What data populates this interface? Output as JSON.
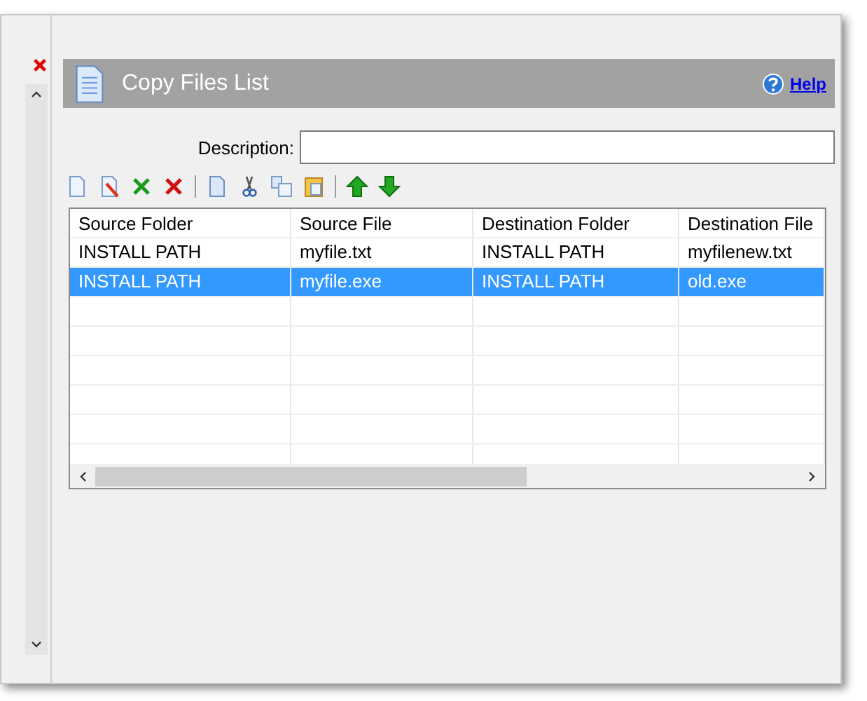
{
  "panel": {
    "title": "Copy Files List",
    "help": "Help"
  },
  "description": {
    "label": "Description:"
  },
  "toolbar": [
    {
      "kind": "new"
    },
    {
      "kind": "edit"
    },
    {
      "kind": "check-x"
    },
    {
      "kind": "delete"
    },
    {
      "kind": "sep"
    },
    {
      "kind": "copy"
    },
    {
      "kind": "cut"
    },
    {
      "kind": "duplicate"
    },
    {
      "kind": "paste"
    },
    {
      "kind": "sep"
    },
    {
      "kind": "up"
    },
    {
      "kind": "down"
    }
  ],
  "table": {
    "columns": [
      "Source Folder",
      "Source File",
      "Destination Folder",
      "Destination File"
    ],
    "rows": [
      {
        "cells": [
          "INSTALL PATH",
          "myfile.txt",
          "INSTALL PATH",
          "myfilenew.txt"
        ],
        "selected": false
      },
      {
        "cells": [
          "INSTALL PATH",
          "myfile.exe",
          "INSTALL PATH",
          "old.exe"
        ],
        "selected": true
      }
    ]
  }
}
